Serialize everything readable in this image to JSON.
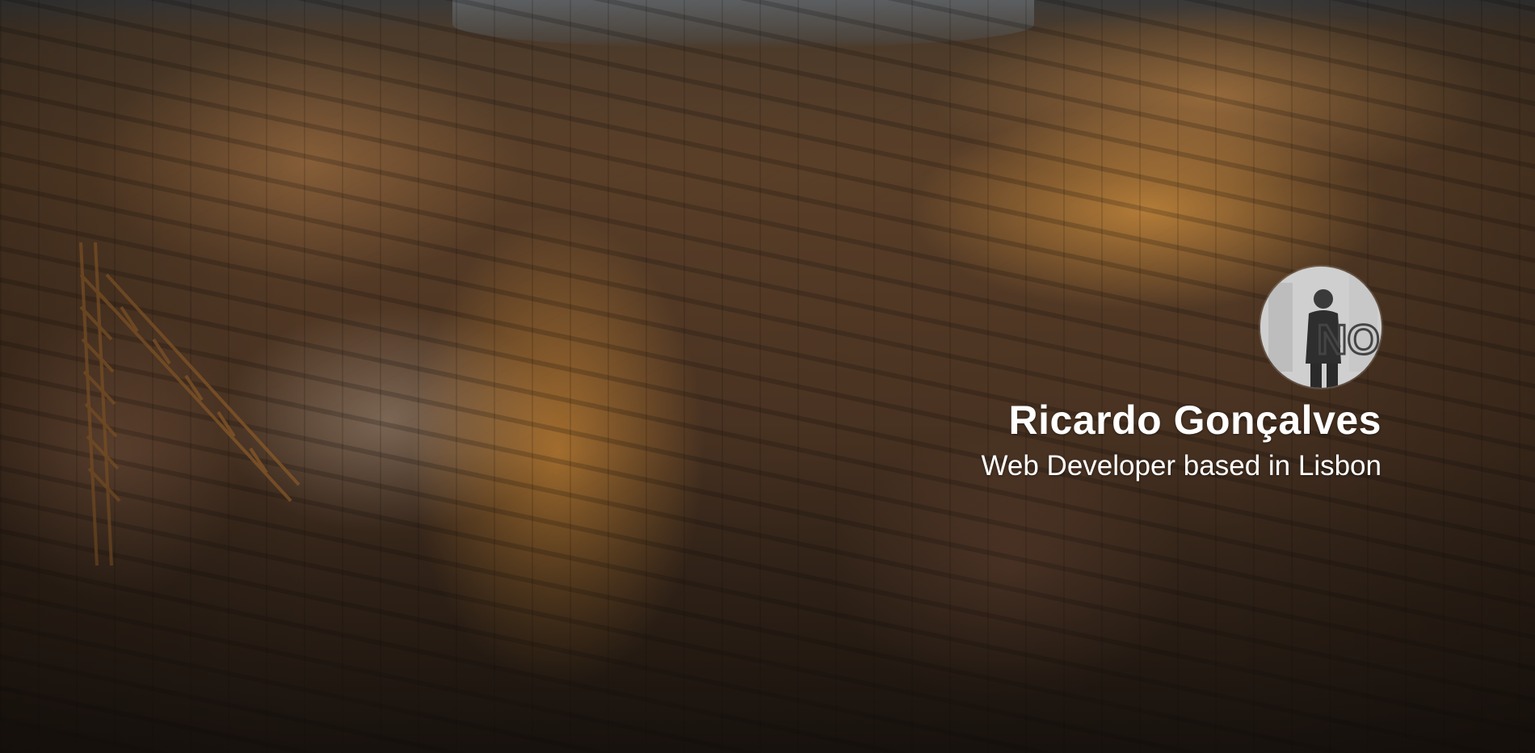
{
  "profile": {
    "name": "Ricardo Gonçalves",
    "tagline": "Web Developer based in Lisbon"
  },
  "avatar": {
    "graffiti_text": "NO"
  },
  "colors": {
    "text": "#ffffff",
    "warm_light": "#ffb046",
    "background_dark": "#1a1410"
  }
}
